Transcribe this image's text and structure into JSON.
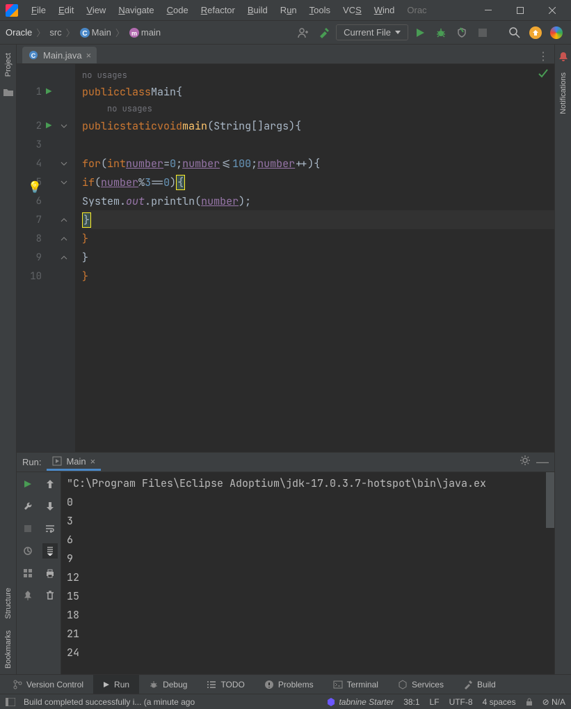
{
  "menu": {
    "file": "File",
    "edit": "Edit",
    "view": "View",
    "navigate": "Navigate",
    "code": "Code",
    "refactor": "Refactor",
    "build": "Build",
    "run": "Run",
    "tools": "Tools",
    "vcs": "VCS",
    "window": "Window",
    "oracle": "Oracle"
  },
  "breadcrumb": {
    "project": "Oracle",
    "src": "src",
    "class": "Main",
    "method": "main"
  },
  "run_config": "Current File",
  "tab": {
    "filename": "Main.java"
  },
  "editor": {
    "hint_noUsages": "no usages",
    "line1": {
      "kw_public": "public",
      "kw_class": "class",
      "name": "Main"
    },
    "line2": {
      "kw_public": "public",
      "kw_static": "static",
      "kw_void": "void",
      "mname": "main",
      "ptype": "String[]",
      "pname": "args"
    },
    "line4": {
      "kw_for": "for",
      "kw_int": "int",
      "var": "number",
      "eq": "=",
      "zero": "0",
      "lte": "<=",
      "hundred": "100",
      "inc": "++"
    },
    "line5": {
      "kw_if": "if",
      "var": "number",
      "mod": "%",
      "three": "3",
      "eqeq": "==",
      "zero": "0"
    },
    "line6": {
      "sys": "System",
      "out": "out",
      "println": "println",
      "var": "number"
    },
    "line_numbers": [
      "1",
      "2",
      "3",
      "4",
      "5",
      "6",
      "7",
      "8",
      "9",
      "10"
    ]
  },
  "run": {
    "label": "Run:",
    "tab": "Main",
    "cmd": "\"C:\\Program Files\\Eclipse Adoptium\\jdk-17.0.3.7-hotspot\\bin\\java.ex",
    "out": [
      "0",
      "3",
      "6",
      "9",
      "12",
      "15",
      "18",
      "21",
      "24"
    ]
  },
  "bottom_tabs": {
    "vcs": "Version Control",
    "run": "Run",
    "debug": "Debug",
    "todo": "TODO",
    "problems": "Problems",
    "terminal": "Terminal",
    "services": "Services",
    "build": "Build"
  },
  "status": {
    "msg": "Build completed successfully i... (a minute ago",
    "tabnine": "tabnine Starter",
    "caret": "38:1",
    "lf": "LF",
    "enc": "UTF-8",
    "indent": "4 spaces",
    "readonly": "N/A"
  },
  "right_rail": {
    "notifications": "Notifications"
  },
  "left_rail": {
    "project": "Project",
    "structure": "Structure",
    "bookmarks": "Bookmarks"
  }
}
